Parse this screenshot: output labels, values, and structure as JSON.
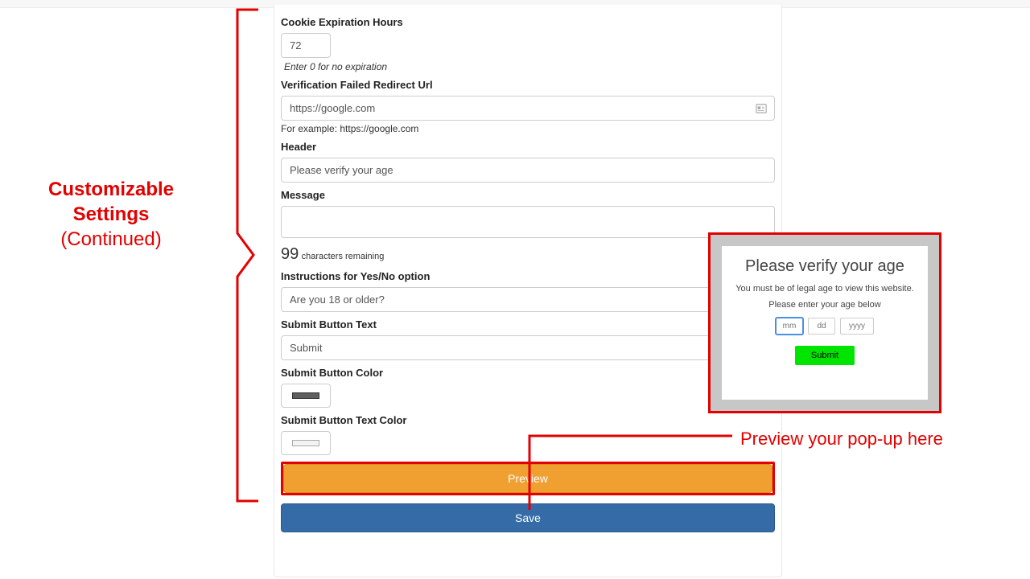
{
  "annotations": {
    "left_line1": "Customizable",
    "left_line2": "Settings",
    "left_line3": "(Continued)",
    "preview_note": "Preview your pop-up here"
  },
  "form": {
    "cookie": {
      "label": "Cookie Expiration Hours",
      "value": "72",
      "help": "Enter 0 for no expiration"
    },
    "redirect": {
      "label": "Verification Failed Redirect Url",
      "value": "https://google.com",
      "help": "For example: https://google.com"
    },
    "header": {
      "label": "Header",
      "value": "Please verify your age"
    },
    "message": {
      "label": "Message",
      "value": "",
      "chars_count": "99",
      "chars_suffix": "characters remaining"
    },
    "instructions": {
      "label": "Instructions for Yes/No option",
      "value": "Are you 18 or older?"
    },
    "submit_text": {
      "label": "Submit Button Text",
      "value": "Submit"
    },
    "submit_color": {
      "label": "Submit Button Color"
    },
    "submit_text_color": {
      "label": "Submit Button Text Color"
    },
    "preview_btn": "Preview",
    "save_btn": "Save"
  },
  "popup": {
    "title": "Please verify your age",
    "msg": "You must be of legal age to view this website.",
    "instr": "Please enter your age below",
    "mm": "mm",
    "dd": "dd",
    "yyyy": "yyyy",
    "submit": "Submit"
  }
}
